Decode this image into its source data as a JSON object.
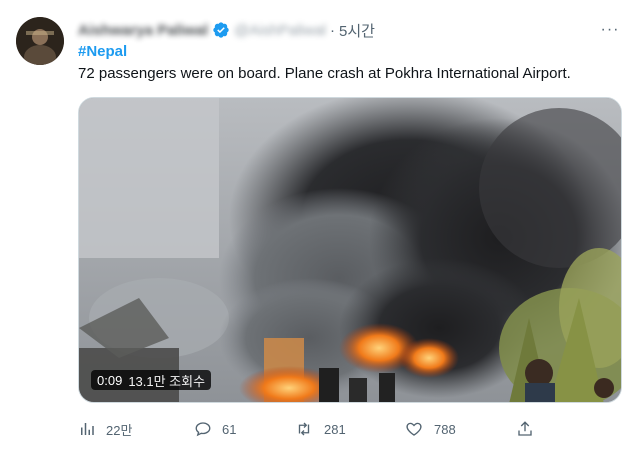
{
  "tweet": {
    "author": {
      "display_name": "Aishwarya Paliwal",
      "handle": "@AishPaliwal",
      "verified": true,
      "avatar_icon": "avatar-photo"
    },
    "separator": "·",
    "time": "5시간",
    "more_label": "···",
    "hashtag": "#Nepal",
    "text": "72 passengers were on board. Plane crash at Pokhra International Airport.",
    "media": {
      "type": "video",
      "duration": "0:09",
      "views": "13.1만 조회수"
    },
    "actions": {
      "views": {
        "icon": "analytics-icon",
        "count": "22만"
      },
      "reply": {
        "icon": "reply-icon",
        "count": "61"
      },
      "retweet": {
        "icon": "retweet-icon",
        "count": "281"
      },
      "like": {
        "icon": "heart-icon",
        "count": "788"
      },
      "share": {
        "icon": "share-icon",
        "count": ""
      }
    }
  },
  "colors": {
    "link": "#1d9bf0",
    "secondary_text": "#536471",
    "primary_text": "#0f1419",
    "verified": "#1d9bf0"
  }
}
